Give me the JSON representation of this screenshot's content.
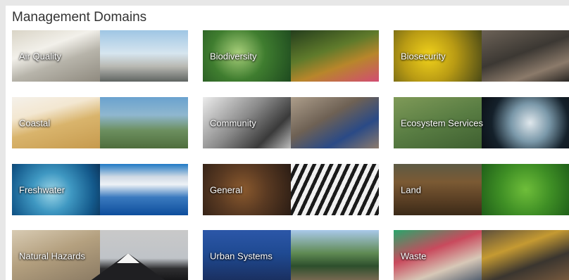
{
  "header": {
    "title": "Management Domains"
  },
  "domains": [
    {
      "label": "Air Quality"
    },
    {
      "label": "Biodiversity"
    },
    {
      "label": "Biosecurity"
    },
    {
      "label": "Coastal"
    },
    {
      "label": "Community"
    },
    {
      "label": "Ecosystem Services"
    },
    {
      "label": "Freshwater"
    },
    {
      "label": "General"
    },
    {
      "label": "Land"
    },
    {
      "label": "Natural Hazards"
    },
    {
      "label": "Urban Systems"
    },
    {
      "label": "Waste"
    }
  ]
}
